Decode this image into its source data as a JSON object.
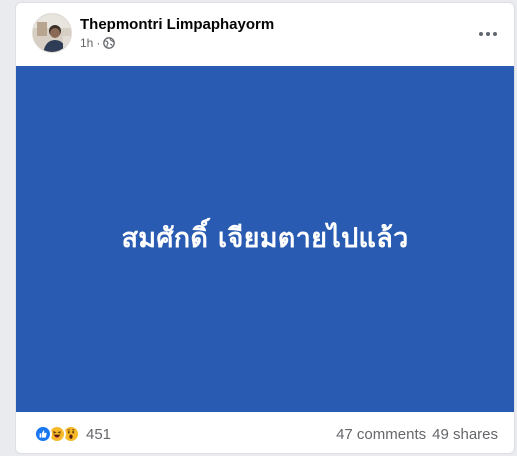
{
  "post": {
    "author": "Thepmontri Limpaphayorm",
    "time": "1h",
    "privacy_icon": "globe-icon",
    "menu_icon": "more-options-icon",
    "media_text": "สมศักดิ์ เจียมตายไปแล้ว",
    "media_background": "#285bb1"
  },
  "footer": {
    "reaction_icons": [
      "like-reaction-icon",
      "haha-reaction-icon",
      "wow-reaction-icon"
    ],
    "reaction_count": "451",
    "comments": "47 comments",
    "shares": "49 shares"
  }
}
